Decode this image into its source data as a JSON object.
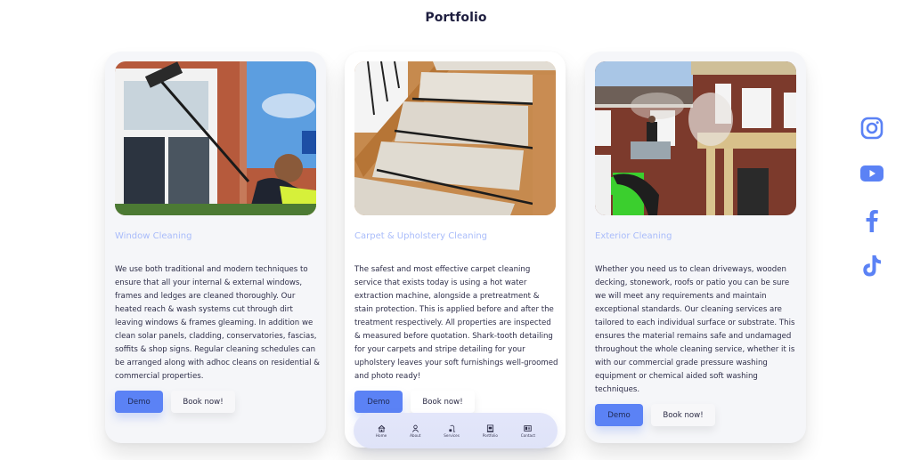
{
  "page": {
    "title": "Portfolio"
  },
  "colors": {
    "accent": "#5b82f5",
    "card_title": "#a9bcfa",
    "text": "#2d2d48",
    "nav_bg": "#e0e4f8"
  },
  "cards": [
    {
      "image_alt": "Worker cleaning upstairs windows of a red brick house with a water-fed pole",
      "title": "Window Cleaning",
      "description": "We use both traditional and modern techniques to ensure that all your internal & external windows, frames and ledges are cleaned thoroughly. Our heated reach & wash systems cut through dirt leaving windows & frames gleaming. In addition we clean solar panels, cladding, conservatories, fascias, soffits & shop signs. Regular cleaning schedules can be arranged along with adhoc cleans on residential & commercial properties.",
      "demo_label": "Demo",
      "book_label": "Book now!"
    },
    {
      "image_alt": "Cream carpeted staircase with black stair rods on wooden steps",
      "title": "Carpet & Upholstery Cleaning",
      "description": "The safest and most effective carpet cleaning service that exists today is using a hot water extraction machine, alongside a pretreatment & stain protection. This is applied before and after the treatment respectively. All properties are inspected & measured before quotation. Shark-tooth detailing for your carpets and stripe detailing for your upholstery leaves your soft furnishings well-groomed and photo ready!",
      "demo_label": "Demo",
      "book_label": "Book now!"
    },
    {
      "image_alt": "Worker on a green cherry picker pressure washing a brick building facade",
      "title": "Exterior Cleaning",
      "description": "Whether you need us to clean driveways, wooden decking, stonework, roofs or patio you can be sure we will meet any requirements and maintain exceptional standards. Our cleaning services are tailored to each individual surface or substrate. This ensures the material remains safe and undamaged throughout the whole cleaning service, whether it is with our commercial grade pressure washing equipment or chemical aided soft washing techniques.",
      "demo_label": "Demo",
      "book_label": "Book now!"
    }
  ],
  "bottom_nav": [
    {
      "label": "Home",
      "icon": "home-icon"
    },
    {
      "label": "About",
      "icon": "user-icon"
    },
    {
      "label": "Services",
      "icon": "vacuum-icon"
    },
    {
      "label": "Portfolio",
      "icon": "portfolio-icon"
    },
    {
      "label": "Contact",
      "icon": "contact-card-icon"
    }
  ],
  "social": [
    {
      "name": "Instagram",
      "icon": "instagram-icon"
    },
    {
      "name": "YouTube",
      "icon": "youtube-icon"
    },
    {
      "name": "Facebook",
      "icon": "facebook-icon"
    },
    {
      "name": "TikTok",
      "icon": "tiktok-icon"
    }
  ]
}
